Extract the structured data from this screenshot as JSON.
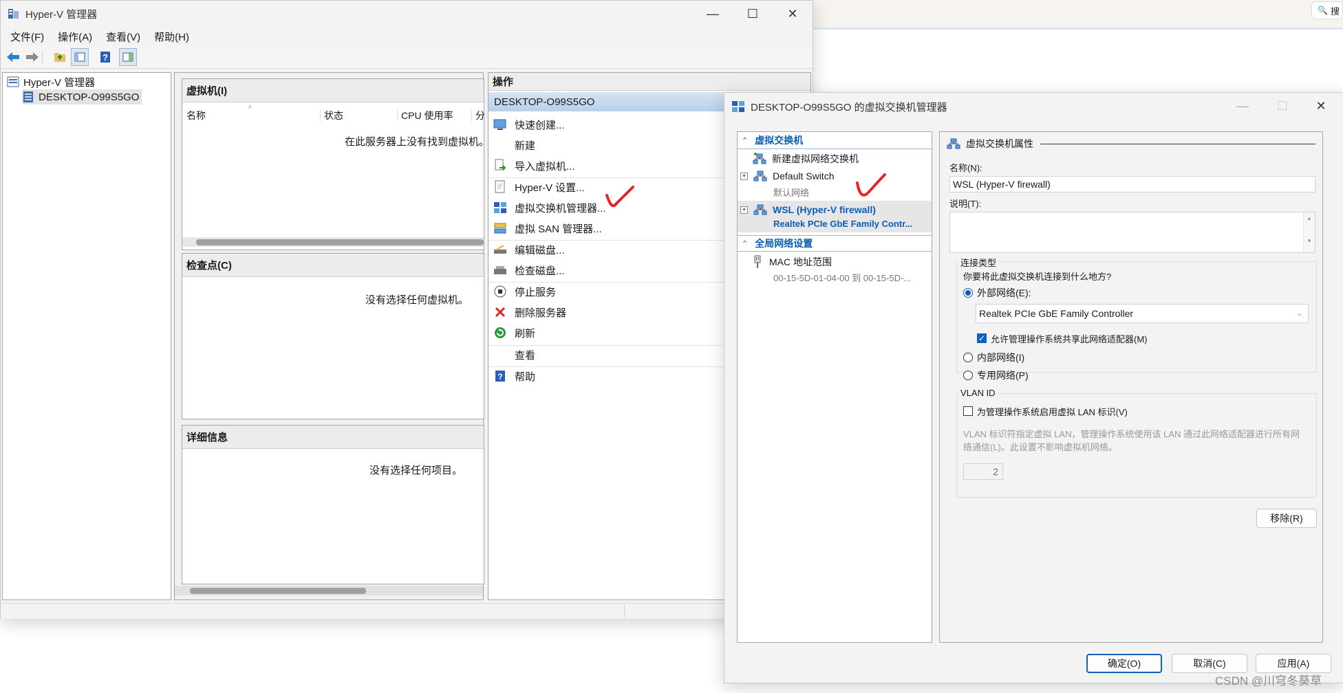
{
  "browser_bg": {
    "search_glyph": "🔍",
    "search_partial": "搜"
  },
  "hyperv": {
    "title": "Hyper-V 管理器",
    "menu": [
      "文件(F)",
      "操作(A)",
      "查看(V)",
      "帮助(H)"
    ],
    "tree": {
      "root": "Hyper-V 管理器",
      "server": "DESKTOP-O99S5GO"
    },
    "vm_section": {
      "title": "虚拟机(I)",
      "columns": [
        "名称",
        "状态",
        "CPU 使用率",
        "分"
      ],
      "empty": "在此服务器上没有找到虚拟机。"
    },
    "checkpoint_section": {
      "title": "检查点(C)",
      "empty": "没有选择任何虚拟机。"
    },
    "detail_section": {
      "title": "详细信息",
      "empty": "没有选择任何项目。"
    },
    "actions": {
      "title": "操作",
      "server": "DESKTOP-O99S5GO",
      "items": [
        "快速创建...",
        "新建",
        "导入虚拟机...",
        "Hyper-V 设置...",
        "虚拟交换机管理器...",
        "虚拟 SAN 管理器...",
        "编辑磁盘...",
        "检查磁盘...",
        "停止服务",
        "删除服务器",
        "刷新",
        "查看",
        "帮助"
      ]
    }
  },
  "vsm": {
    "title": "DESKTOP-O99S5GO 的虚拟交换机管理器",
    "left": {
      "header_switches": "虚拟交换机",
      "new_switch": "新建虚拟网络交换机",
      "default_switch": "Default Switch",
      "default_switch_sub": "默认网络",
      "wsl_switch": "WSL (Hyper-V firewall)",
      "wsl_switch_sub": "Realtek PCIe GbE Family Contr...",
      "header_global": "全局网络设置",
      "mac_range": "MAC 地址范围",
      "mac_range_sub": "00-15-5D-01-04-00 到 00-15-5D-..."
    },
    "right": {
      "section_title": "虚拟交换机属性",
      "name_label": "名称(N):",
      "name_value": "WSL (Hyper-V firewall)",
      "desc_label": "说明(T):",
      "conn_type_label": "连接类型",
      "conn_question": "你要将此虚拟交换机连接到什么地方?",
      "external": "外部网络(E):",
      "adapter": "Realtek PCIe GbE Family Controller",
      "allow_mgmt": "允许管理操作系统共享此网络适配器(M)",
      "internal": "内部网络(I)",
      "private": "专用网络(P)",
      "vlan_label": "VLAN ID",
      "vlan_enable": "为管理操作系统启用虚拟 LAN 标识(V)",
      "vlan_help": "VLAN 标识符指定虚拟 LAN，管理操作系统使用该 LAN 通过此网络适配器进行所有网络通信(L)。此设置不影响虚拟机网络。",
      "vlan_value": "2",
      "remove": "移除(R)"
    },
    "buttons": {
      "ok": "确定(O)",
      "cancel": "取消(C)",
      "apply": "应用(A)"
    }
  },
  "watermark": "CSDN @川穹冬葵草"
}
